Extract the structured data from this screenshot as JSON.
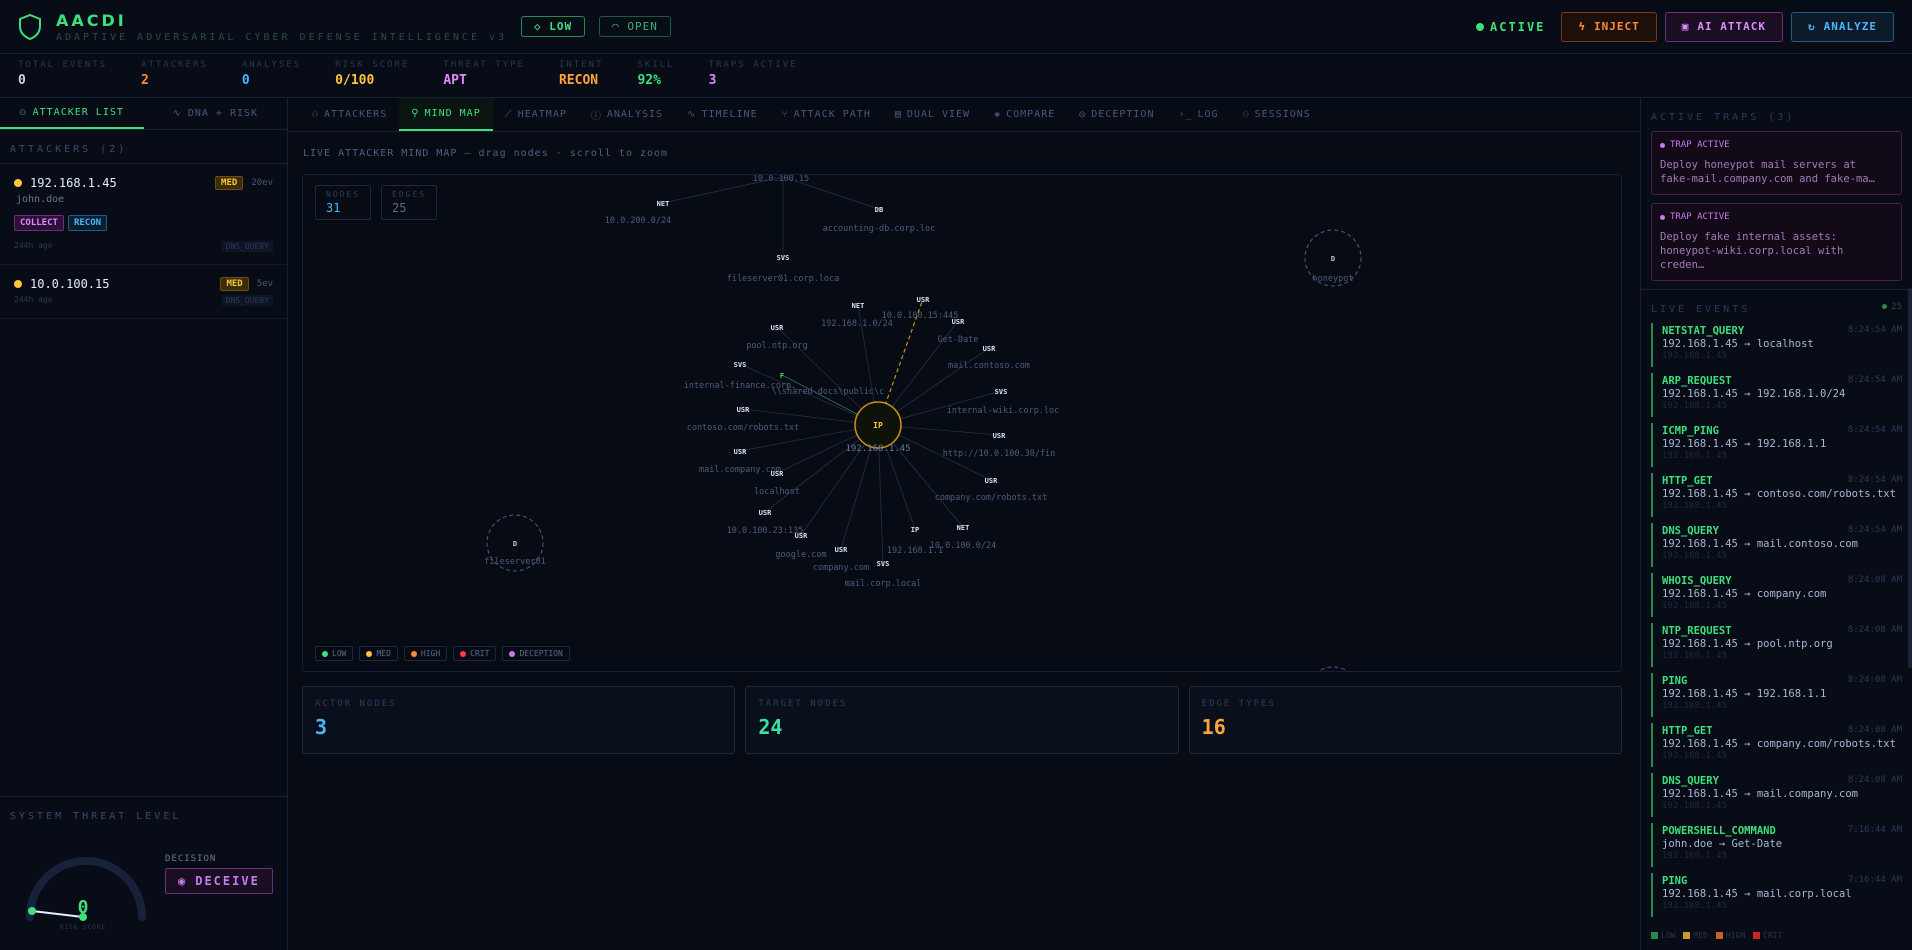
{
  "header": {
    "title": "AACDI",
    "subtitle": "ADAPTIVE ADVERSARIAL CYBER DEFENSE INTELLIGENCE v3",
    "level_pill": "◇ LOW",
    "open_pill": "OPEN",
    "status": "ACTIVE",
    "inject_label": "INJECT",
    "ai_attack_label": "AI ATTACK",
    "analyze_label": "ANALYZE"
  },
  "stats": [
    {
      "label": "TOTAL EVENTS",
      "value": "0",
      "color": "#c8d3e6"
    },
    {
      "label": "ATTACKERS",
      "value": "2",
      "color": "#ff8a3a"
    },
    {
      "label": "ANALYSES",
      "value": "0",
      "color": "#4ab6ff"
    },
    {
      "label": "RISK SCORE",
      "value": "0/100",
      "color": "#ffc43a"
    },
    {
      "label": "THREAT TYPE",
      "value": "APT",
      "color": "#e08aff"
    },
    {
      "label": "INTENT",
      "value": "RECON",
      "color": "#ffa53a"
    },
    {
      "label": "SKILL",
      "value": "92%",
      "color": "#3de07a"
    },
    {
      "label": "TRAPS ACTIVE",
      "value": "3",
      "color": "#e08aff"
    }
  ],
  "left": {
    "tab_attackers": "ATTACKER LIST",
    "tab_dna": "DNA + RISK",
    "section": "ATTACKERS (2)",
    "attackers": [
      {
        "ip": "192.168.1.45",
        "severity": "MED",
        "events": "20ev",
        "user": "john.doe",
        "tags": [
          "COLLECT",
          "RECON"
        ],
        "age": "244h ago",
        "last": "DNS_QUERY"
      },
      {
        "ip": "10.0.100.15",
        "severity": "MED",
        "events": "5ev",
        "user": "",
        "tags": [],
        "age": "244h ago",
        "last": "DNS_QUERY"
      }
    ],
    "threat_label": "SYSTEM THREAT LEVEL",
    "gauge_value": "0",
    "gauge_caption": "RISK SCORE",
    "decision_label": "DECISION",
    "decision_value": "DECEIVE"
  },
  "center": {
    "tabs": [
      "ATTACKERS",
      "MIND MAP",
      "HEATMAP",
      "ANALYSIS",
      "TIMELINE",
      "ATTACK PATH",
      "DUAL VIEW",
      "COMPARE",
      "DECEPTION",
      "LOG",
      "SESSIONS"
    ],
    "active_tab": "MIND MAP",
    "caption": "LIVE ATTACKER MIND MAP — drag nodes · scroll to zoom",
    "nodes_label": "NODES",
    "nodes_value": "31",
    "edges_label": "EDGES",
    "edges_value": "25",
    "legend": [
      {
        "label": "LOW",
        "color": "#3de07a"
      },
      {
        "label": "MED",
        "color": "#ffc43a"
      },
      {
        "label": "HIGH",
        "color": "#ff8a3a"
      },
      {
        "label": "CRIT",
        "color": "#ff3a4a"
      },
      {
        "label": "DECEPTION",
        "color": "#c87aef"
      }
    ],
    "cards": [
      {
        "label": "ACTOR NODES",
        "value": "3",
        "color": "#4ab6ff"
      },
      {
        "label": "TARGET NODES",
        "value": "24",
        "color": "#3de0a0"
      },
      {
        "label": "EDGE TYPES",
        "value": "16",
        "color": "#ffa53a"
      }
    ]
  },
  "mindmap": {
    "hub": {
      "glyph": "IP",
      "label": "192.168.1.45"
    },
    "nodes": [
      {
        "g": "NET",
        "label": "10.0.200.0/24",
        "type": "net"
      },
      {
        "g": "",
        "label": "10.0.100.15",
        "type": "actor"
      },
      {
        "g": "DB",
        "label": "accounting-db.corp.loc",
        "type": "db"
      },
      {
        "g": "SVS",
        "label": "fileserver01.corp.loca",
        "type": "svc"
      },
      {
        "g": "NET",
        "label": "192.168.1.0/24",
        "type": "net"
      },
      {
        "g": "USR",
        "label": "10.0.100.15:445",
        "type": "usr"
      },
      {
        "g": "USR",
        "label": "Get-Date",
        "type": "usr"
      },
      {
        "g": "USR",
        "label": "pool.ntp.org",
        "type": "usr"
      },
      {
        "g": "USR",
        "label": "mail.contoso.com",
        "type": "usr"
      },
      {
        "g": "SVS",
        "label": "internal-finance.corp.",
        "type": "svc"
      },
      {
        "g": "F",
        "label": "\\\\shared-docs\\public\\c",
        "type": "file"
      },
      {
        "g": "SVS",
        "label": "internal-wiki.corp.loc",
        "type": "svc"
      },
      {
        "g": "USR",
        "label": "contoso.com/robots.txt",
        "type": "usr"
      },
      {
        "g": "USR",
        "label": "http://10.0.100.30/fin",
        "type": "usr"
      },
      {
        "g": "USR",
        "label": "mail.company.com",
        "type": "usr"
      },
      {
        "g": "USR",
        "label": "localhost",
        "type": "usr"
      },
      {
        "g": "USR",
        "label": "company.com/robots.txt",
        "type": "usr"
      },
      {
        "g": "USR",
        "label": "10.0.100.23:135",
        "type": "usr"
      },
      {
        "g": "NET",
        "label": "10.0.100.0/24",
        "type": "net"
      },
      {
        "g": "USR",
        "label": "google.com",
        "type": "usr"
      },
      {
        "g": "IP",
        "label": "192.168.1.1",
        "type": "ip"
      },
      {
        "g": "USR",
        "label": "company.com",
        "type": "usr"
      },
      {
        "g": "SVS",
        "label": "mail.corp.local",
        "type": "svc"
      }
    ],
    "decoys": [
      {
        "g": "D",
        "label": "honeypot"
      },
      {
        "g": "D",
        "label": "fileserver01"
      },
      {
        "g": "D",
        "label": ""
      }
    ]
  },
  "right": {
    "traps_title": "ACTIVE TRAPS (3)",
    "trap_badge": "TRAP ACTIVE",
    "traps": [
      {
        "text": "Deploy honeypot mail servers at fake-mail.company.com and fake-ma…"
      },
      {
        "text": "Deploy fake internal assets: honeypot-wiki.corp.local with creden…"
      }
    ],
    "events_title": "LIVE EVENTS",
    "events_count": "25",
    "events": [
      {
        "type": "NETSTAT_QUERY",
        "line": "192.168.1.45 → localhost",
        "src": "192.168.1.45",
        "time": "8:24:54 AM"
      },
      {
        "type": "ARP_REQUEST",
        "line": "192.168.1.45 → 192.168.1.0/24",
        "src": "192.168.1.45",
        "time": "8:24:54 AM"
      },
      {
        "type": "ICMP_PING",
        "line": "192.168.1.45 → 192.168.1.1",
        "src": "192.168.1.45",
        "time": "8:24:54 AM"
      },
      {
        "type": "HTTP_GET",
        "line": "192.168.1.45 → contoso.com/robots.txt",
        "src": "192.168.1.45",
        "time": "8:24:54 AM"
      },
      {
        "type": "DNS_QUERY",
        "line": "192.168.1.45 → mail.contoso.com",
        "src": "192.168.1.45",
        "time": "8:24:54 AM"
      },
      {
        "type": "WHOIS_QUERY",
        "line": "192.168.1.45 → company.com",
        "src": "192.168.1.45",
        "time": "8:24:08 AM"
      },
      {
        "type": "NTP_REQUEST",
        "line": "192.168.1.45 → pool.ntp.org",
        "src": "192.168.1.45",
        "time": "8:24:08 AM"
      },
      {
        "type": "PING",
        "line": "192.168.1.45 → 192.168.1.1",
        "src": "192.168.1.45",
        "time": "8:24:08 AM"
      },
      {
        "type": "HTTP_GET",
        "line": "192.168.1.45 → company.com/robots.txt",
        "src": "192.168.1.45",
        "time": "8:24:08 AM"
      },
      {
        "type": "DNS_QUERY",
        "line": "192.168.1.45 → mail.company.com",
        "src": "192.168.1.45",
        "time": "8:24:08 AM"
      },
      {
        "type": "POWERSHELL_COMMAND",
        "line": "john.doe → Get-Date",
        "src": "192.168.1.45",
        "time": "7:16:44 AM"
      },
      {
        "type": "PING",
        "line": "192.168.1.45 → mail.corp.local",
        "src": "192.168.1.45",
        "time": "7:16:44 AM"
      }
    ],
    "footer_legend": [
      {
        "label": "LOW",
        "color": "#2a8a4a"
      },
      {
        "label": "MED",
        "color": "#c89a2a"
      },
      {
        "label": "HIGH",
        "color": "#c8602a"
      },
      {
        "label": "CRIT",
        "color": "#c8262a"
      }
    ]
  }
}
